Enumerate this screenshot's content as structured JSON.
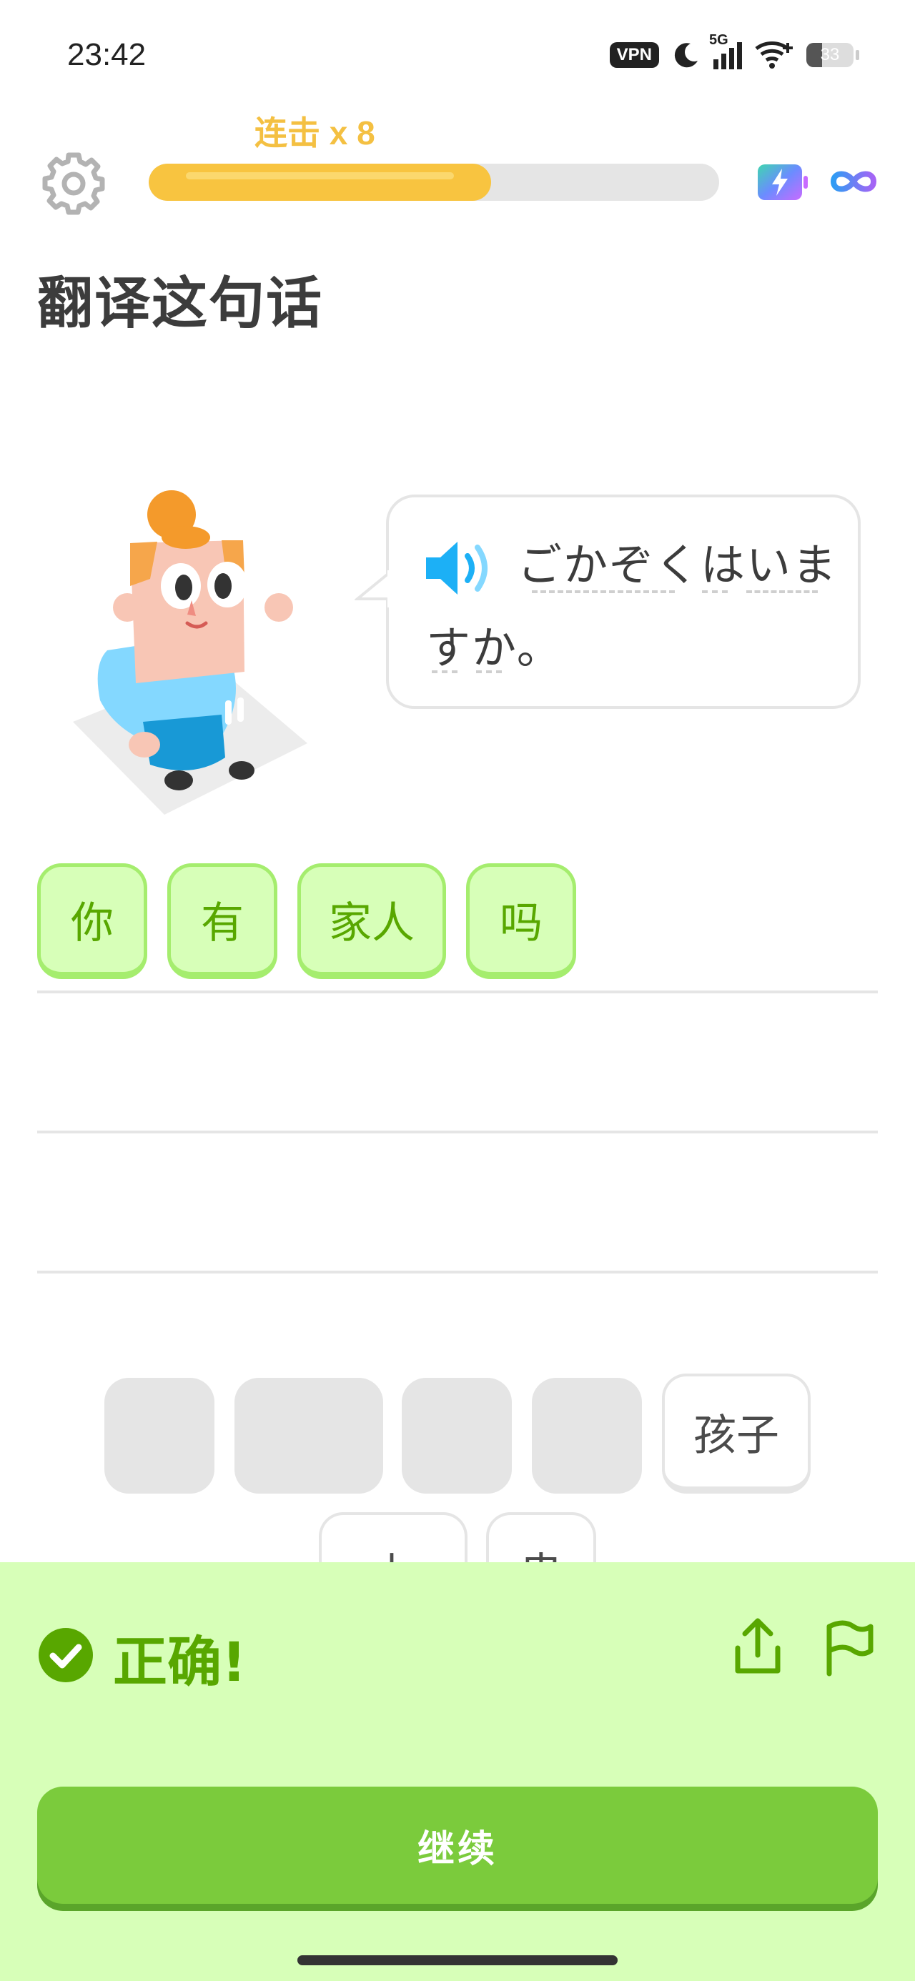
{
  "status_bar": {
    "time": "23:42",
    "vpn": "VPN",
    "network": "5G",
    "battery": "33",
    "battery_level": 0.33
  },
  "top_bar": {
    "streak": "连击 x 8",
    "progress": 0.6,
    "icons": [
      "gear-icon",
      "boost-icon",
      "infinity-icon"
    ]
  },
  "prompt": {
    "title": "翻译这句话"
  },
  "sentence": {
    "line1": "ごかぞくはいま",
    "line2": "すか。"
  },
  "answer": {
    "words": [
      "你",
      "有",
      "家人",
      "吗"
    ]
  },
  "word_bank": {
    "visible_word": "孩子",
    "partial_words": [
      "上",
      "串"
    ]
  },
  "feedback": {
    "status": "正确!",
    "continue_label": "继续"
  },
  "colors": {
    "correct_green": "#58a700",
    "feedback_bg": "#d7ffb8",
    "button_green": "#7bcb3c",
    "streak_yellow": "#f4c042"
  }
}
